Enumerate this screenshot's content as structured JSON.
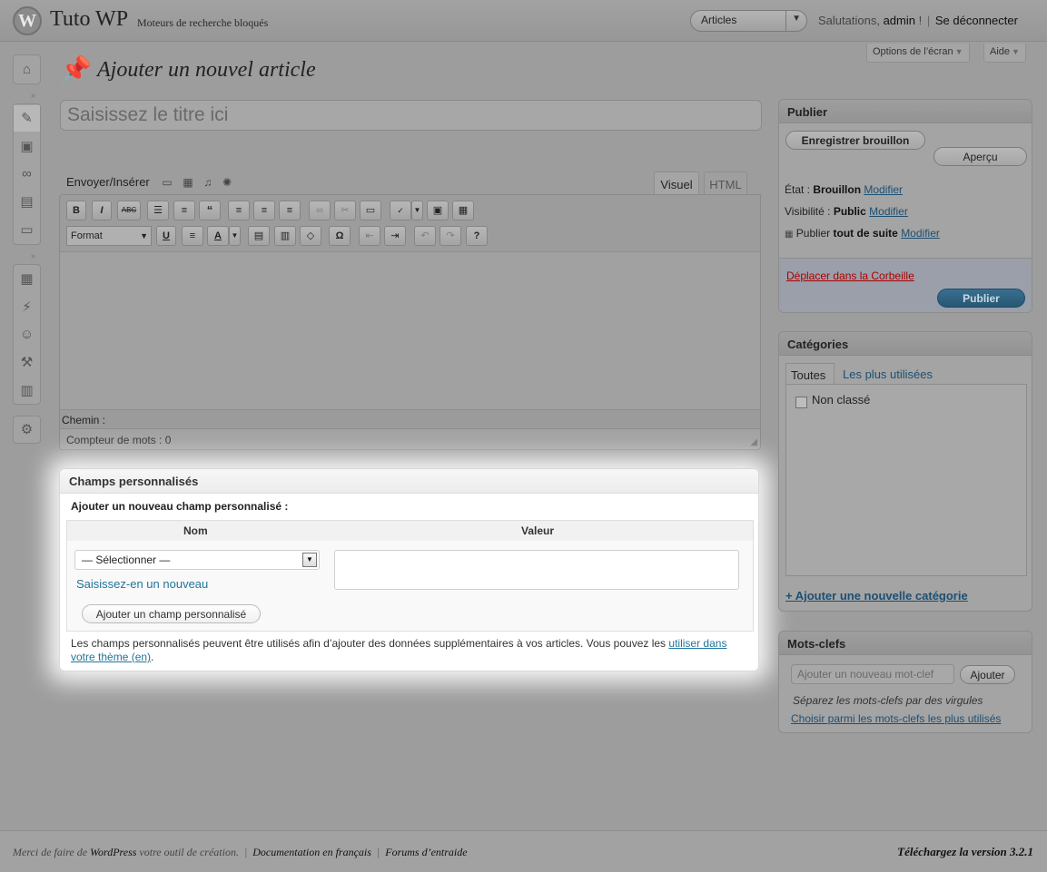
{
  "header": {
    "logo": "W",
    "site_title": "Tuto WP",
    "tagline": "Moteurs de recherche bloqués",
    "favorites_selected": "Articles",
    "greeting": "Salutations,",
    "user_name": "admin",
    "greeting_end": "!",
    "logout_label": "Se déconnecter",
    "screen_options_label": "Options de l’écran",
    "help_label": "Aide"
  },
  "menu_icons": [
    "dashboard-icon",
    "posts-icon",
    "media-icon",
    "links-icon",
    "pages-icon",
    "comments-icon",
    "appearance-icon",
    "plugins-icon",
    "users-icon",
    "tools-icon",
    "settings-icon",
    "collapse-icon"
  ],
  "page": {
    "title": "Ajouter un nouvel article",
    "title_placeholder": "Saisissez le titre ici"
  },
  "editor": {
    "upload_label": "Envoyer/Insérer",
    "tab_visual": "Visuel",
    "tab_html": "HTML",
    "format_label": "Format",
    "path_label": "Chemin :",
    "word_count": "Compteur de mots : 0"
  },
  "custom_fields": {
    "title": "Champs personnalisés",
    "subtitle": "Ajouter un nouveau champ personnalisé :",
    "col_name": "Nom",
    "col_value": "Valeur",
    "select_value": "— Sélectionner —",
    "new_link": "Saisissez-en un nouveau",
    "add_button": "Ajouter un champ personnalisé",
    "help_text": "Les champs personnalisés peuvent être utilisés afin d’ajouter des données supplémentaires à vos articles. Vous pouvez les",
    "help_link": "utiliser dans votre thème (en)",
    "help_end": "."
  },
  "publish": {
    "title": "Publier",
    "save_draft": "Enregistrer brouillon",
    "preview": "Aperçu",
    "status_label": "État :",
    "status_value": "Brouillon",
    "visibility_label": "Visibilité :",
    "visibility_value": "Public",
    "schedule_label": "Publier",
    "schedule_value": "tout de suite",
    "edit_link": "Modifier",
    "trash": "Déplacer dans la Corbeille",
    "publish_button": "Publier"
  },
  "categories": {
    "title": "Catégories",
    "tab_all": "Toutes",
    "tab_popular": "Les plus utilisées",
    "items": [
      "Non classé"
    ],
    "add_link": "+ Ajouter une nouvelle catégorie"
  },
  "tags": {
    "title": "Mots-clefs",
    "input_placeholder": "Ajouter un nouveau mot-clef",
    "add_button": "Ajouter",
    "hint": "Séparez les mots-clefs par des virgules",
    "popular_link": "Choisir parmi les mots-clefs les plus utilisés"
  },
  "footer": {
    "thanks_prefix": "Merci de faire de",
    "wordpress": "WordPress",
    "thanks_suffix": "votre outil de création.",
    "doc_link": "Documentation en français",
    "forums_link": "Forums d’entraide",
    "version": "Téléchargez la version 3.2.1"
  }
}
